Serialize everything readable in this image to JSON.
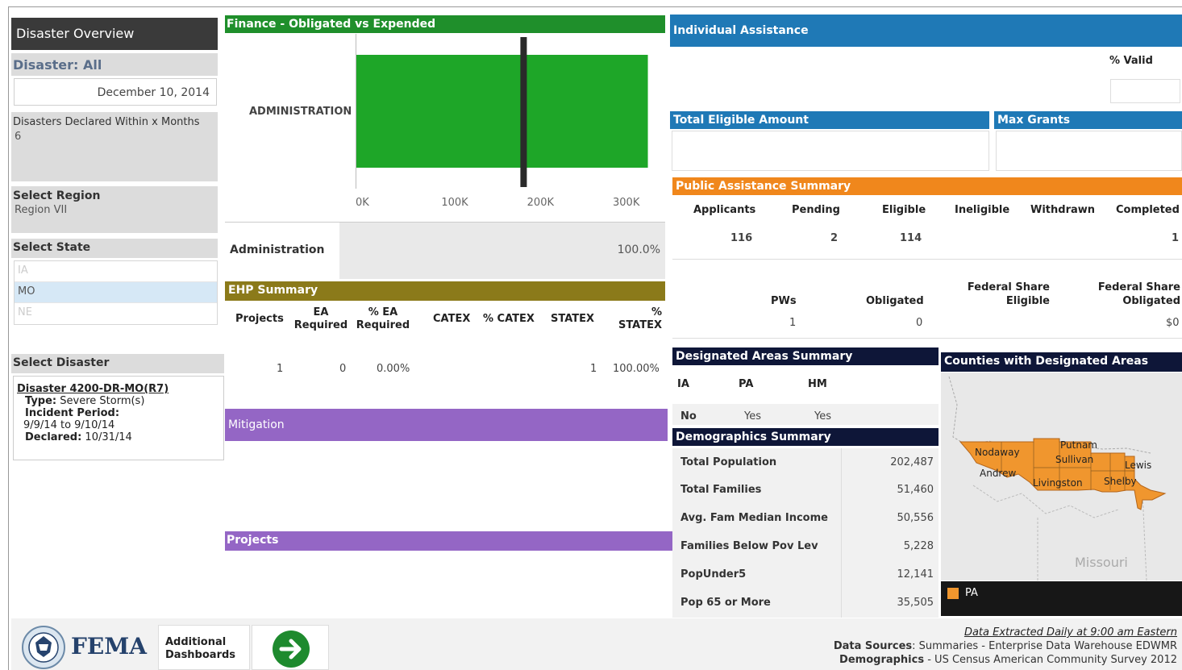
{
  "left": {
    "overview_title": "Disaster Overview",
    "disaster_label": "Disaster: All",
    "date": "December 10, 2014",
    "declared_within_label": "Disasters Declared Within x Months",
    "declared_within_value": "6",
    "region_label": "Select Region",
    "region_value": "Region VII",
    "state_label": "Select State",
    "states": [
      "IA",
      "MO",
      "NE"
    ],
    "selected_state": "MO",
    "disaster_select_label": "Select Disaster",
    "disaster_link": "Disaster 4200-DR-MO(R7)",
    "type_label": "Type:",
    "type_value": "Severe Storm(s)",
    "incident_label": "Incident Period:",
    "incident_value": "9/9/14 to 9/10/14",
    "declared_label": "Declared:",
    "declared_value": "10/31/14"
  },
  "finance": {
    "title": "Finance - Obligated vs Expended",
    "row_label": "ADMINISTRATION",
    "ticks": [
      "0K",
      "100K",
      "200K",
      "300K"
    ],
    "summary_label": "Administration",
    "summary_value": "100.0%"
  },
  "chart_data": {
    "type": "bar",
    "orientation": "horizontal",
    "categories": [
      "ADMINISTRATION"
    ],
    "series": [
      {
        "values": [
          340000
        ]
      },
      {
        "values": [
          196000
        ]
      }
    ],
    "xlim": [
      0,
      350000
    ],
    "tick_labels": [
      "0K",
      "100K",
      "200K",
      "300K"
    ],
    "colors": [
      "#1ea628",
      "#2a2a2a"
    ]
  },
  "ehp": {
    "title": "EHP Summary",
    "headers": [
      "Projects",
      "EA Required",
      "% EA Required",
      "CATEX",
      "% CATEX",
      "STATEX",
      "% STATEX"
    ],
    "values": [
      "1",
      "0",
      "0.00%",
      "",
      "",
      "1",
      "100.00%"
    ]
  },
  "mitigation_title": "Mitigation",
  "projects_title": "Projects",
  "ia": {
    "title": "Individual Assistance",
    "valid_label": "% Valid",
    "total_eligible_label": "Total Eligible Amount",
    "max_grants_label": "Max Grants"
  },
  "pa": {
    "title": "Public Assistance Summary",
    "headers": [
      "Applicants",
      "Pending",
      "Eligible",
      "Ineligible",
      "Withdrawn",
      "Completed"
    ],
    "values": [
      "116",
      "2",
      "114",
      "",
      "",
      "1"
    ],
    "headers2": [
      "PWs",
      "Obligated",
      "Federal Share Eligible",
      "Federal Share Obligated"
    ],
    "values2": [
      "1",
      "0",
      "",
      "$0"
    ]
  },
  "designated": {
    "title": "Designated Areas Summary",
    "headers": [
      "IA",
      "PA",
      "HM"
    ],
    "values": [
      "No",
      "Yes",
      "Yes"
    ]
  },
  "demographics": {
    "title": "Demographics Summary",
    "rows": [
      {
        "label": "Total Population",
        "value": "202,487"
      },
      {
        "label": "Total Families",
        "value": "51,460"
      },
      {
        "label": "Avg. Fam Median Income",
        "value": "50,556"
      },
      {
        "label": "Families Below Pov Lev",
        "value": "5,228"
      },
      {
        "label": "PopUnder5",
        "value": "12,141"
      },
      {
        "label": "Pop 65 or More",
        "value": "35,505"
      }
    ]
  },
  "map": {
    "title": "Counties with Designated Areas",
    "counties": [
      "Nodaway",
      "Putnam",
      "Sullivan",
      "Andrew",
      "Lewis",
      "Livingston",
      "Shelby"
    ],
    "state_label": "Missouri",
    "legend_label": "PA",
    "legend_color": "#f0962e"
  },
  "footer": {
    "fema": "FEMA",
    "additional": "Additional",
    "dashboards": "Dashboards",
    "extracted": "Data Extracted Daily at 9:00 am Eastern",
    "sources_label": "Data Sources",
    "sources_value": ": Summaries - Enterprise Data Warehouse EDWMR",
    "demo_label": "Demographics",
    "demo_value": " - US Census American Community Survey 2012"
  }
}
